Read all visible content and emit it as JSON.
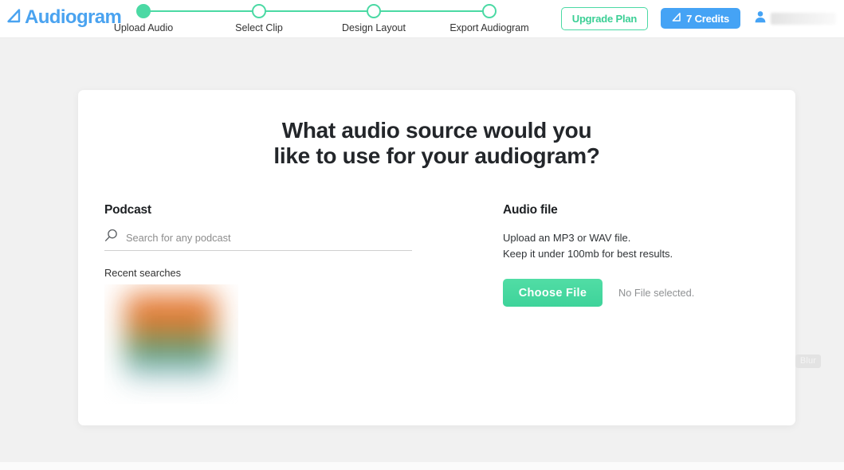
{
  "header": {
    "logo": {
      "text": "Audiogram",
      "mark_icon": "play-triangle-icon",
      "color": "#4aa3f0"
    },
    "stepper": {
      "steps": [
        {
          "label": "Upload Audio",
          "state": "active"
        },
        {
          "label": "Select Clip",
          "state": "pending"
        },
        {
          "label": "Design Layout",
          "state": "pending"
        },
        {
          "label": "Export Audiogram",
          "state": "pending"
        }
      ],
      "accent_color": "#4bd9a4"
    },
    "upgrade_button": {
      "label": "Upgrade Plan",
      "color": "#3bcf95"
    },
    "credits_button": {
      "label": "7 Credits",
      "icon": "triangle-icon",
      "color": "#45a3f5"
    },
    "account": {
      "icon": "person-icon",
      "name": "",
      "redacted": true
    }
  },
  "main": {
    "headline_line1": "What audio source would you",
    "headline_line2": "like to use for your audiogram?",
    "podcast": {
      "title": "Podcast",
      "search": {
        "icon": "search-icon",
        "value": "",
        "placeholder": "Search for any podcast"
      },
      "recent_label": "Recent searches",
      "recent_items": [
        {
          "title": "",
          "blurred": true
        }
      ]
    },
    "audio_file": {
      "title": "Audio file",
      "desc_line1": "Upload an MP3 or WAV file.",
      "desc_line2": "Keep it under 100mb for best results.",
      "choose_button": {
        "label": "Choose File",
        "color": "#45d79f"
      },
      "file_status": "No File selected."
    }
  },
  "overlay": {
    "blur_badge": "Blur"
  }
}
